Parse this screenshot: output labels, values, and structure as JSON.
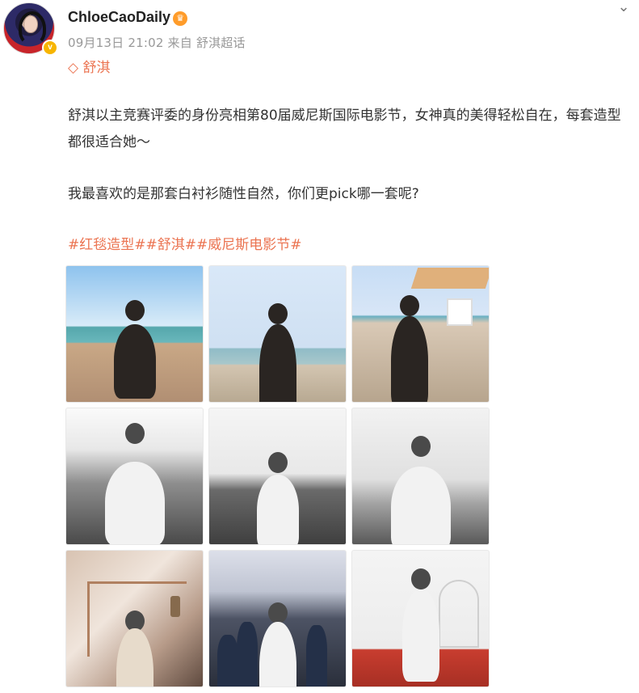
{
  "user": {
    "name": "ChloeCaoDaily",
    "badge_icon": "crown-badge-icon",
    "verified_icon": "verified-v-icon"
  },
  "post": {
    "meta": "09月13日 21:02  来自 舒淇超话",
    "topic": "舒淇",
    "text_paragraphs": [
      "舒淇以主竞赛评委的身份亮相第80届威尼斯国际电影节，女神真的美得轻松自在，每套造型都很适合她～",
      "我最喜欢的是那套白衬衫随性自然，你们更pick哪一套呢?"
    ],
    "hashtags": "#红毯造型##舒淇##威尼斯电影节#"
  },
  "images": [
    {
      "type": "beach",
      "name": "photo-1"
    },
    {
      "type": "beach",
      "name": "photo-2"
    },
    {
      "type": "beach",
      "name": "photo-3"
    },
    {
      "type": "bw",
      "name": "photo-4"
    },
    {
      "type": "bw",
      "name": "photo-5"
    },
    {
      "type": "bw",
      "name": "photo-6"
    },
    {
      "type": "stairs",
      "name": "photo-7"
    },
    {
      "type": "red-carpet",
      "name": "photo-8"
    },
    {
      "type": "event",
      "name": "photo-9"
    }
  ],
  "colors": {
    "accent": "#eb7350",
    "meta": "#999999",
    "text": "#333333",
    "badge": "#ff9c2a",
    "verified": "#f7b500"
  }
}
